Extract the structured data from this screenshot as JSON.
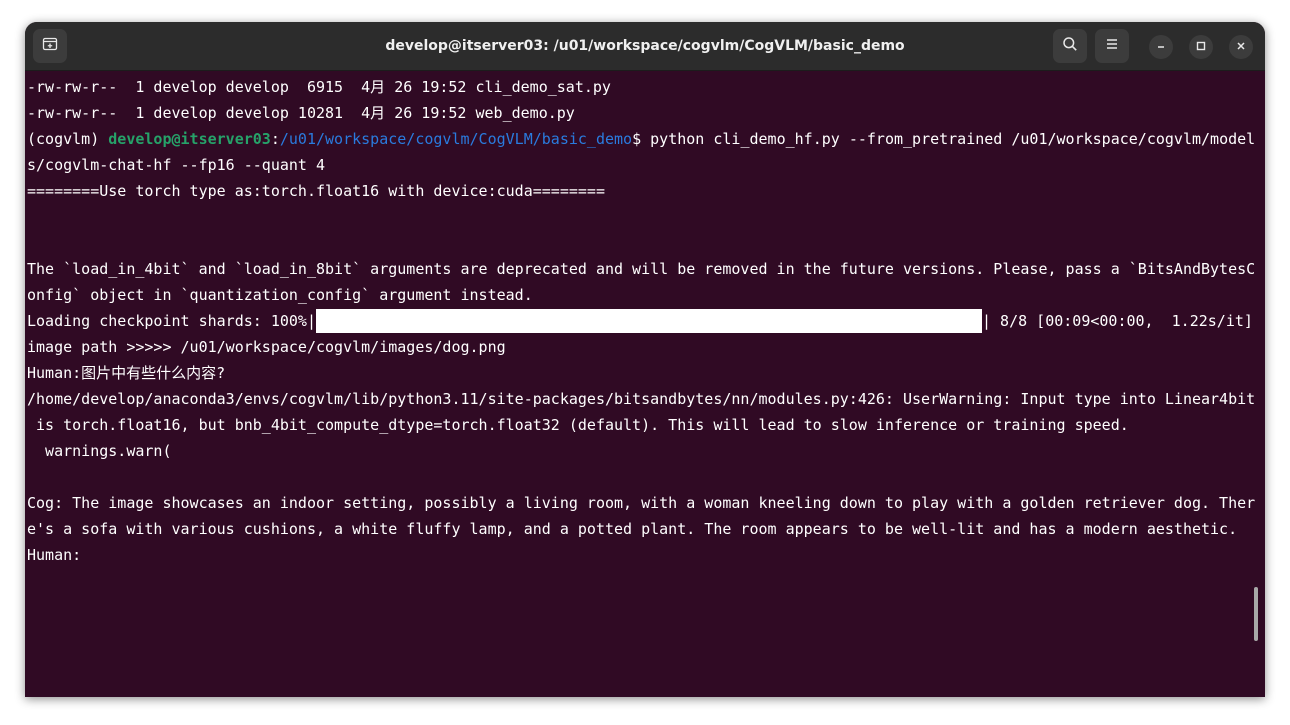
{
  "window": {
    "title": "develop@itserver03: /u01/workspace/cogvlm/CogVLM/basic_demo"
  },
  "titlebar": {
    "new_tab_icon": "new-tab-icon",
    "search_icon": "search-icon",
    "menu_icon": "hamburger-menu-icon",
    "minimize_icon": "minimize-icon",
    "maximize_icon": "maximize-icon",
    "close_icon": "close-icon"
  },
  "terminal": {
    "lines": [
      "-rw-rw-r--  1 develop develop  6915  4月 26 19:52 cli_demo_sat.py",
      "-rw-rw-r--  1 develop develop 10281  4月 26 19:52 web_demo.py",
      "",
      "s/cogvlm-chat-hf --fp16 --quant 4",
      "========Use torch type as:torch.float16 with device:cuda========",
      "",
      "",
      "The `load_in_4bit` and `load_in_8bit` arguments are deprecated and will be removed in the future versions. Please, pass a `BitsAndBytesC",
      "onfig` object in `quantization_config` argument instead.",
      "",
      "image path >>>>> /u01/workspace/cogvlm/images/dog.png",
      "Human:图片中有些什么内容?",
      "/home/develop/anaconda3/envs/cogvlm/lib/python3.11/site-packages/bitsandbytes/nn/modules.py:426: UserWarning: Input type into Linear4bit",
      " is torch.float16, but bnb_4bit_compute_dtype=torch.float32 (default). This will lead to slow inference or training speed.",
      "  warnings.warn(",
      "",
      "Cog: The image showcases an indoor setting, possibly a living room, with a woman kneeling down to play with a golden retriever dog. Ther",
      "e's a sofa with various cushions, a white fluffy lamp, and a potted plant. The room appears to be well-lit and has a modern aesthetic.",
      "Human:"
    ],
    "prompt": {
      "env": "(cogvlm) ",
      "user_host": "develop@itserver03",
      "colon": ":",
      "path": "/u01/workspace/cogvlm/CogVLM/basic_demo",
      "dollar": "$ ",
      "command": "python cli_demo_hf.py --from_pretrained /u01/workspace/cogvlm/model"
    },
    "progress": {
      "prefix": "Loading checkpoint shards: 100%|",
      "suffix": "| 8/8 [00:09<00:00,  1.22s/it]",
      "fraction": 1.0
    }
  },
  "colors": {
    "terminal_bg": "#300a24",
    "prompt_user": "#26a269",
    "prompt_path": "#2a7bde",
    "titlebar_bg": "#2c2c2c"
  }
}
